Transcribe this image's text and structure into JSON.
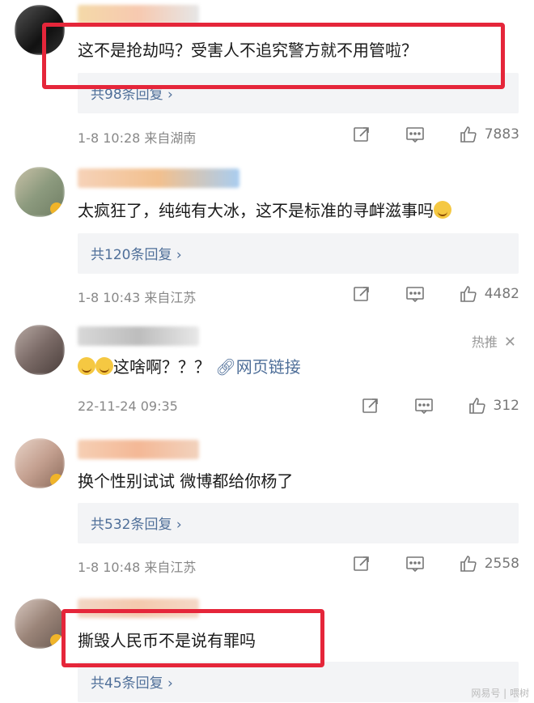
{
  "comments": [
    {
      "content": "这不是抢劫吗？受害人不追究警方就不用管啦？",
      "replies": "共98条回复 ›",
      "meta": "1-8 10:28  来自湖南",
      "likes": "7883",
      "avatar_colors": [
        "#3b3b3b",
        "#1c1c1c"
      ]
    },
    {
      "content": "太疯狂了，纯纯有大冰，这不是标准的寻衅滋事吗",
      "replies": "共120条回复 ›",
      "meta": "1-8 10:43  来自江苏",
      "likes": "4482",
      "avatar_colors": [
        "#8c9a7e",
        "#c9c2a8"
      ]
    },
    {
      "content_prefix": "这啥啊？？？",
      "link_text": "网页链接",
      "meta": "22-11-24 09:35",
      "likes": "312",
      "hot_label": "热推",
      "avatar_colors": [
        "#7a6a66",
        "#b8a9a4"
      ]
    },
    {
      "content": "换个性别试试 微博都给你杨了",
      "replies": "共532条回复 ›",
      "meta": "1-8 10:48  来自江苏",
      "likes": "2558",
      "avatar_colors": [
        "#c4a090",
        "#e8d4c8"
      ]
    },
    {
      "content": "撕毁人民币不是说有罪吗",
      "replies": "共45条回复 ›",
      "avatar_colors": [
        "#9a8478",
        "#d8c8c0"
      ]
    }
  ],
  "watermark": "网易号 | 喂树",
  "colors": {
    "accent_blue": "#4f6f99",
    "highlight_red": "#e5263a"
  }
}
